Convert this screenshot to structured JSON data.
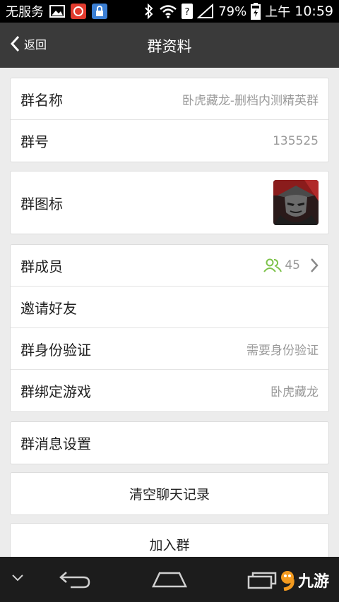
{
  "status_bar": {
    "carrier": "无服务",
    "battery": "79%",
    "ampm": "上午",
    "time": "10:59"
  },
  "header": {
    "back_label": "返回",
    "title": "群资料"
  },
  "group_info": {
    "name_label": "群名称",
    "name_value": "卧虎藏龙-删档内测精英群",
    "id_label": "群号",
    "id_value": "135525"
  },
  "group_icon": {
    "label": "群图标"
  },
  "members_section": {
    "members_label": "群成员",
    "members_count": "45",
    "invite_label": "邀请好友",
    "verify_label": "群身份验证",
    "verify_value": "需要身份验证",
    "game_label": "群绑定游戏",
    "game_value": "卧虎藏龙"
  },
  "message_settings": {
    "label": "群消息设置"
  },
  "actions": {
    "clear_label": "清空聊天记录",
    "join_label": "加入群"
  },
  "watermark": {
    "text": "九游"
  },
  "icons": {
    "back": "chevron-left-icon",
    "members": "members-icon",
    "arrow": "chevron-right-icon",
    "nav_back": "back-arrow-icon",
    "nav_home": "home-icon",
    "nav_recent": "recent-apps-icon"
  },
  "colors": {
    "accent_green": "#7dc24a",
    "titlebar": "#3a3a3a",
    "background": "#ececec"
  }
}
